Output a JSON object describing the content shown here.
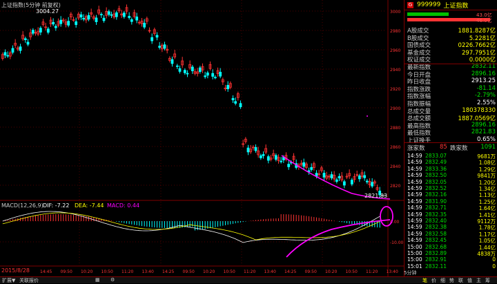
{
  "chart": {
    "title": "上证指数(5分钟 前复权)",
    "high_label": "3004.27",
    "low_label": "2821.83",
    "macd_title": "MACD(12,26,9)",
    "dif_label": "DIF: -7.22",
    "dea_label": "DEA: -7.44",
    "macd_label": "MACD: 0.44",
    "price_axis": [
      "3000",
      "2980",
      "2960",
      "2940",
      "2920",
      "2900",
      "2880",
      "2860",
      "2840",
      "2820"
    ],
    "macd_axis": [
      "0.00",
      "-10.00"
    ],
    "time_labels": [
      "14:45",
      "09:50",
      "10:20",
      "10:50",
      "11:20",
      "13:40",
      "14:25",
      "09:50",
      "10:20",
      "10:50",
      "11:20",
      "13:40",
      "14:25",
      "09:50",
      "10:20",
      "10:50",
      "11:20",
      "13:40",
      "14:40"
    ],
    "left_time_label": "2015/8/28"
  },
  "quote": {
    "badge": "G",
    "code": "999999",
    "name": "上证指数",
    "up_bar_value": "43.0亿",
    "down_bar_value": "46.0亿",
    "rows": [
      {
        "k": "A股成交",
        "v": "1881.8287亿",
        "c": "#ffff00"
      },
      {
        "k": "B股成交",
        "v": "5.2281亿",
        "c": "#ffff00"
      },
      {
        "k": "国债成交",
        "v": "0226.7662亿",
        "c": "#ffff00"
      },
      {
        "k": "基金成交",
        "v": "297.7951亿",
        "c": "#ffff00"
      },
      {
        "k": "权证成交",
        "v": "0.0000亿",
        "c": "#ffff00"
      },
      {
        "k": "最新指数",
        "v": "2832.11",
        "c": "#00e000"
      },
      {
        "k": "今日开盘",
        "v": "2896.16",
        "c": "#00e000"
      },
      {
        "k": "昨日收盘",
        "v": "2913.25",
        "c": "#ffffff"
      },
      {
        "k": "指数涨跌",
        "v": "-81.14",
        "c": "#00e000"
      },
      {
        "k": "指数涨幅",
        "v": "-2.79%",
        "c": "#00e000"
      },
      {
        "k": "指数振幅",
        "v": "2.55%",
        "c": "#ffffff"
      },
      {
        "k": "总成交量",
        "v": "180378330",
        "c": "#ffff00"
      },
      {
        "k": "总成交额",
        "v": "1887.0569亿",
        "c": "#ffff00"
      },
      {
        "k": "最高指数",
        "v": "2896.16",
        "c": "#00e000"
      },
      {
        "k": "最低指数",
        "v": "2821.83",
        "c": "#00e000"
      },
      {
        "k": "上证换手",
        "v": "0.65%",
        "c": "#ffffff"
      }
    ],
    "rise_label": "涨家数",
    "rise_count": "85",
    "fall_label": "跌家数",
    "fall_count": "1091"
  },
  "ticks": [
    {
      "t": "14:59",
      "p": "2833.07",
      "v": "9681万"
    },
    {
      "t": "14:59",
      "p": "2832.49",
      "v": "1.08亿"
    },
    {
      "t": "14:59",
      "p": "2833.36",
      "v": "1.29亿"
    },
    {
      "t": "14:59",
      "p": "2832.50",
      "v": "9841万"
    },
    {
      "t": "14:59",
      "p": "2832.05",
      "v": "1.20亿"
    },
    {
      "t": "14:59",
      "p": "2832.52",
      "v": "1.34亿"
    },
    {
      "t": "14:59",
      "p": "2832.16",
      "v": "1.13亿"
    },
    {
      "t": "14:59",
      "p": "2831.90",
      "v": "1.25亿"
    },
    {
      "t": "14:59",
      "p": "2832.71",
      "v": "1.64亿"
    },
    {
      "t": "14:59",
      "p": "2832.35",
      "v": "1.41亿"
    },
    {
      "t": "14:59",
      "p": "2832.40",
      "v": "9112万"
    },
    {
      "t": "14:59",
      "p": "2832.38",
      "v": "1.78亿"
    },
    {
      "t": "14:59",
      "p": "2832.58",
      "v": "1.17亿"
    },
    {
      "t": "14:59",
      "p": "2832.45",
      "v": "1.05亿"
    },
    {
      "t": "15:00",
      "p": "2832.68",
      "v": "1.44亿"
    },
    {
      "t": "15:00",
      "p": "2832.89",
      "v": "4838万"
    },
    {
      "t": "15:00",
      "p": "2832.91",
      "v": "0"
    },
    {
      "t": "15:01",
      "p": "2832.11",
      "v": "0"
    }
  ],
  "bottom": {
    "tabs": [
      "扩展▼",
      "关联报价"
    ],
    "icons": [
      "grid-icon",
      "settings-icon"
    ],
    "right_tabs": [
      "笔",
      "价",
      "细",
      "势",
      "联",
      "值",
      "主",
      "筹"
    ],
    "period": "5分钟"
  },
  "colors": {
    "up": "#ff3333",
    "down": "#00ffff",
    "highlight": "#ff00ff"
  }
}
